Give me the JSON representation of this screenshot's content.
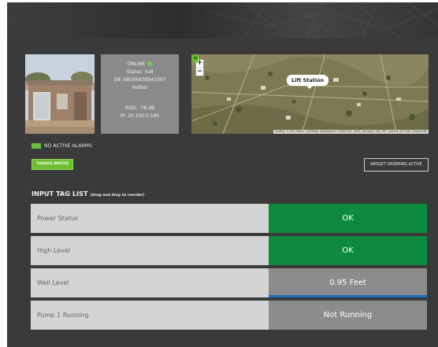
{
  "device": {
    "online_label": "ONLINE",
    "status": "Status: null",
    "sn": "SN: 680X6838041007",
    "carrier": "Hellter",
    "rssi": "RSSI: -78 dB",
    "ip": "IP: 10.100.0.180"
  },
  "map": {
    "zoom_in": "+",
    "zoom_out": "−",
    "popup_label": "Lift Station",
    "popup_close": "×",
    "attribution": "Leaflet | © Esri, Maxar, Earthstar Geographics, USDA FSA, USGS, Aerogrid, IGN, IGP, and the GIS User Community"
  },
  "alarm": {
    "text": "NO ACTIVE ALARMS",
    "color": "#6abf3a"
  },
  "buttons": {
    "toggle_inputs": "TOGGLE INPUTS",
    "widget_ordering": "WIDGET ORDERING ACTIVE"
  },
  "list": {
    "title": "INPUT TAG LIST",
    "subtitle": "(drag and drop to reorder)"
  },
  "tags": [
    {
      "name": "Power Status",
      "value": "OK",
      "color": "#0e8a3e"
    },
    {
      "name": "High Level",
      "value": "OK",
      "color": "#0e8a3e"
    },
    {
      "name": "Well Level",
      "value": "0.95 Feet",
      "color": "#8c8c8c",
      "level_fraction": 1.0,
      "level_color": "#1a6fc0"
    },
    {
      "name": "Pump 1 Running",
      "value": "Not Running",
      "color": "#8c8c8c"
    }
  ],
  "colors": {
    "ok_green": "#0e8a3e",
    "neutral_gray": "#8c8c8c",
    "accent_green": "#6fbf32",
    "online_dot": "#6fcf4a"
  }
}
